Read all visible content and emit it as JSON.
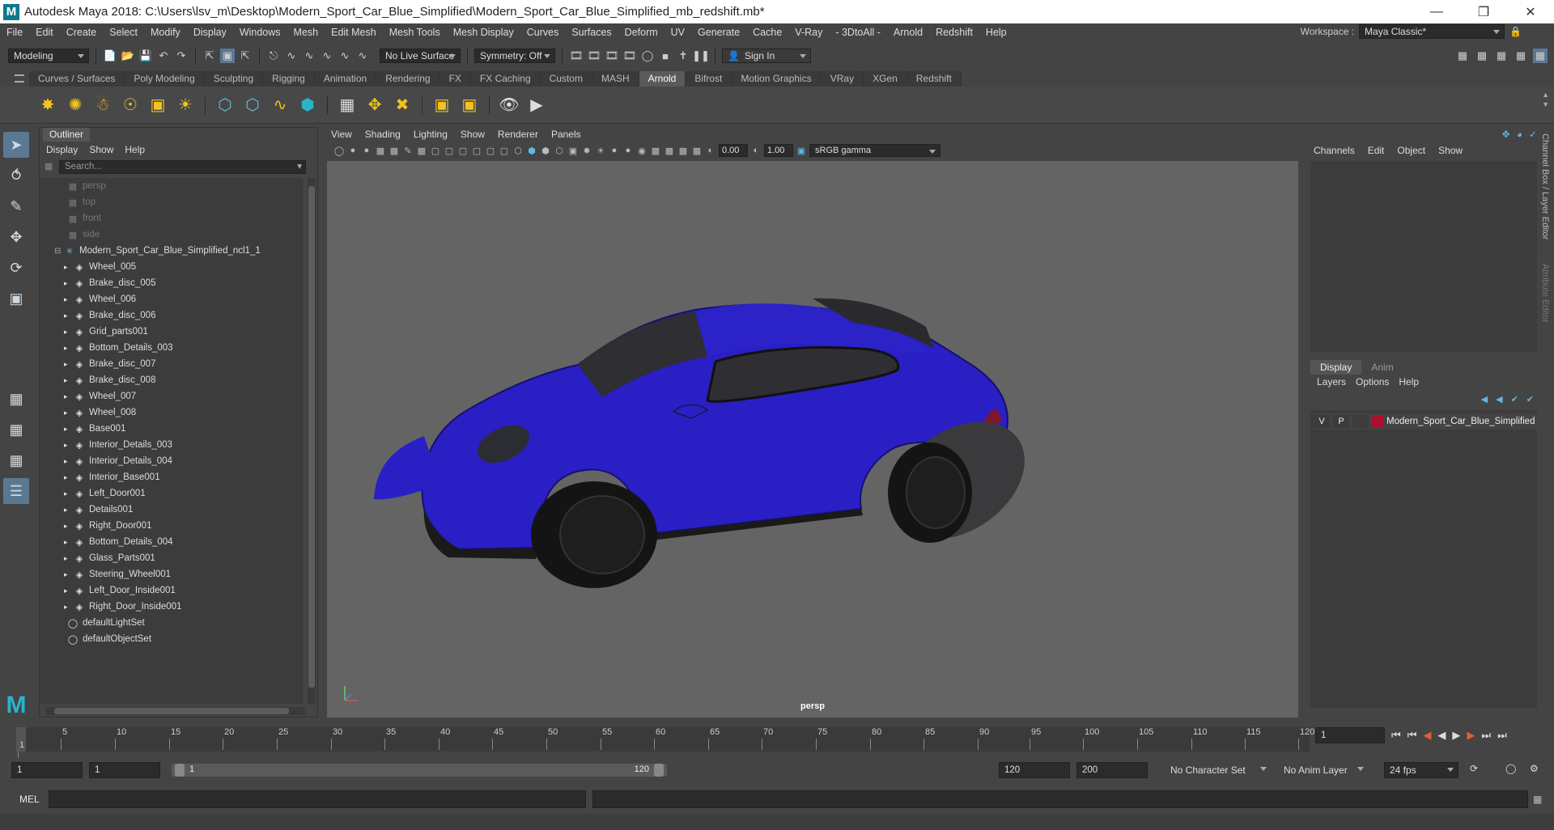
{
  "window": {
    "title": "Autodesk Maya 2018: C:\\Users\\lsv_m\\Desktop\\Modern_Sport_Car_Blue_Simplified\\Modern_Sport_Car_Blue_Simplified_mb_redshift.mb*",
    "logo": "M"
  },
  "menubar": {
    "items": [
      "File",
      "Edit",
      "Create",
      "Select",
      "Modify",
      "Display",
      "Windows",
      "Mesh",
      "Edit Mesh",
      "Mesh Tools",
      "Mesh Display",
      "Curves",
      "Surfaces",
      "Deform",
      "UV",
      "Generate",
      "Cache",
      "V-Ray",
      "- 3DtoAll -",
      "Arnold",
      "Redshift",
      "Help"
    ],
    "workspace_label": "Workspace :",
    "workspace_value": "Maya Classic*"
  },
  "status_line": {
    "mode": "Modeling",
    "live_surface": "No Live Surface",
    "symmetry": "Symmetry: Off",
    "sign_in": "Sign In"
  },
  "shelf": {
    "tabs": [
      "Curves / Surfaces",
      "Poly Modeling",
      "Sculpting",
      "Rigging",
      "Animation",
      "Rendering",
      "FX",
      "FX Caching",
      "Custom",
      "MASH",
      "Arnold",
      "Bifrost",
      "Motion Graphics",
      "VRay",
      "XGen",
      "Redshift"
    ],
    "active_tab": "Arnold"
  },
  "outliner": {
    "title": "Outliner",
    "menu": [
      "Display",
      "Show",
      "Help"
    ],
    "search_placeholder": "Search...",
    "cameras": [
      "persp",
      "top",
      "front",
      "side"
    ],
    "root": "Modern_Sport_Car_Blue_Simplified_ncl1_1",
    "children": [
      "Wheel_005",
      "Brake_disc_005",
      "Wheel_006",
      "Brake_disc_006",
      "Grid_parts001",
      "Bottom_Details_003",
      "Brake_disc_007",
      "Brake_disc_008",
      "Wheel_007",
      "Wheel_008",
      "Base001",
      "Interior_Details_003",
      "Interior_Details_004",
      "Interior_Base001",
      "Left_Door001",
      "Details001",
      "Right_Door001",
      "Bottom_Details_004",
      "Glass_Parts001",
      "Steering_Wheel001",
      "Left_Door_Inside001",
      "Right_Door_Inside001"
    ],
    "sets": [
      "defaultLightSet",
      "defaultObjectSet"
    ]
  },
  "viewport": {
    "menu": [
      "View",
      "Shading",
      "Lighting",
      "Show",
      "Renderer",
      "Panels"
    ],
    "exposure": "0.00",
    "gamma": "1.00",
    "color_space": "sRGB gamma",
    "camera_label": "persp",
    "car_color": "#2a1fc4"
  },
  "channel_box": {
    "menu": [
      "Channels",
      "Edit",
      "Object",
      "Show"
    ]
  },
  "layer_editor": {
    "tabs": [
      "Display",
      "Anim"
    ],
    "active_tab": "Display",
    "menu": [
      "Layers",
      "Options",
      "Help"
    ],
    "layer": {
      "v": "V",
      "p": "P",
      "name": "Modern_Sport_Car_Blue_Simplified",
      "color": "#a8102f"
    }
  },
  "side_tabs": [
    "Channel Box / Layer Editor",
    "Attribute Editor"
  ],
  "timeline": {
    "ticks": [
      "1",
      "5",
      "10",
      "15",
      "20",
      "25",
      "30",
      "35",
      "40",
      "45",
      "50",
      "55",
      "60",
      "65",
      "70",
      "75",
      "80",
      "85",
      "90",
      "95",
      "100",
      "105",
      "110",
      "115",
      "120"
    ],
    "current_frame": "1"
  },
  "range": {
    "start": "1",
    "anim_start": "1",
    "slider_start": "1",
    "slider_end": "120",
    "end": "120",
    "anim_end": "200",
    "character_set": "No Character Set",
    "anim_layer": "No Anim Layer",
    "fps": "24 fps"
  },
  "command_line": {
    "lang": "MEL"
  }
}
